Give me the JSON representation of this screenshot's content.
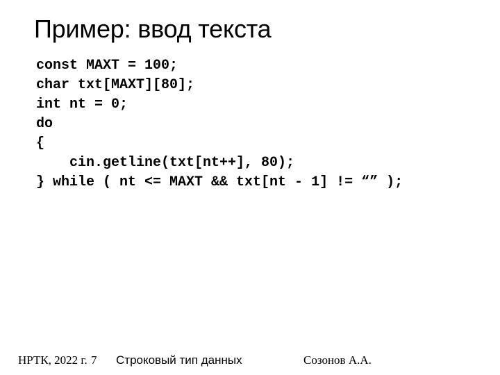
{
  "slide": {
    "title": "Пример: ввод текста",
    "background_color": "#ffffff",
    "text_color": "#000000"
  },
  "code": {
    "language": "cpp",
    "lines": [
      "const MAXT = 100;",
      "char txt[MAXT][80];",
      "int nt = 0;",
      "do",
      "{",
      "    cin.getline(txt[nt++], 80);",
      "} while ( nt <= MAXT && txt[nt - 1] != “” );"
    ]
  },
  "footer": {
    "organization": "НРТК, 2022 г.",
    "page_number": "7",
    "topic": "Строковый тип данных",
    "author": "Созонов А.А."
  }
}
